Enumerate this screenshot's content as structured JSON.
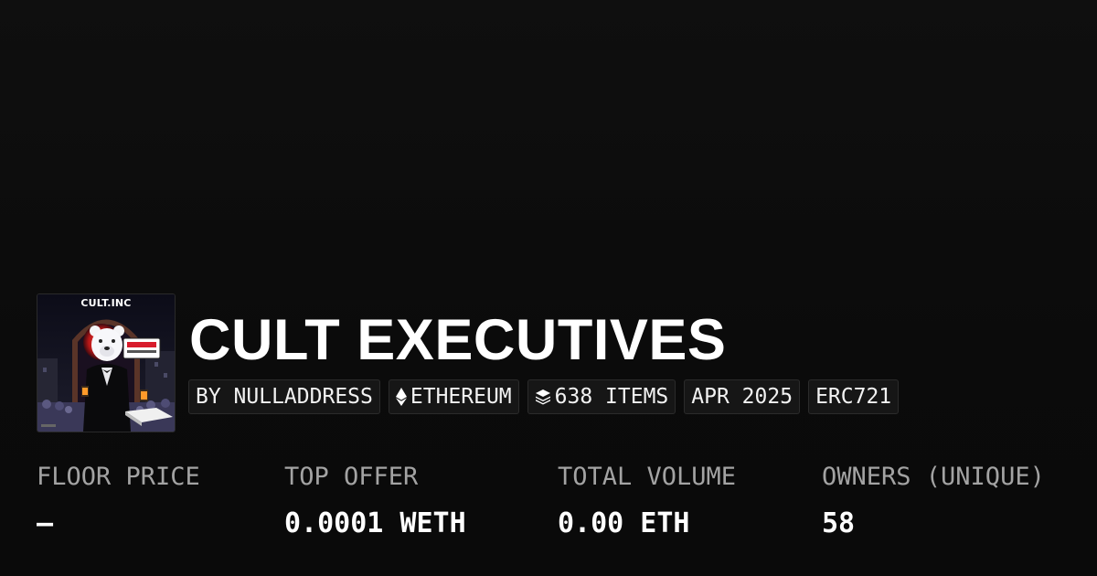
{
  "collection": {
    "title": "CULT EXECUTIVES",
    "avatar_brand": "CULT.INC"
  },
  "tags": {
    "creator": "BY NULLADDRESS",
    "chain": "ETHEREUM",
    "chain_icon": "ethereum-icon",
    "items": "638 ITEMS",
    "items_icon": "layers-icon",
    "date": "APR 2025",
    "standard": "ERC721"
  },
  "stats": {
    "floor_price": {
      "label": "FLOOR PRICE",
      "value": "—"
    },
    "top_offer": {
      "label": "TOP OFFER",
      "value": "0.0001 WETH"
    },
    "total_volume": {
      "label": "TOTAL VOLUME",
      "value": "0.00 ETH"
    },
    "owners": {
      "label": "OWNERS (UNIQUE)",
      "value": "58"
    }
  },
  "colors": {
    "background": "#0b0b0b",
    "text": "#ffffff",
    "muted": "#a3a3a3",
    "tag_bg": "#161616",
    "tag_border": "#2b2b2b"
  }
}
